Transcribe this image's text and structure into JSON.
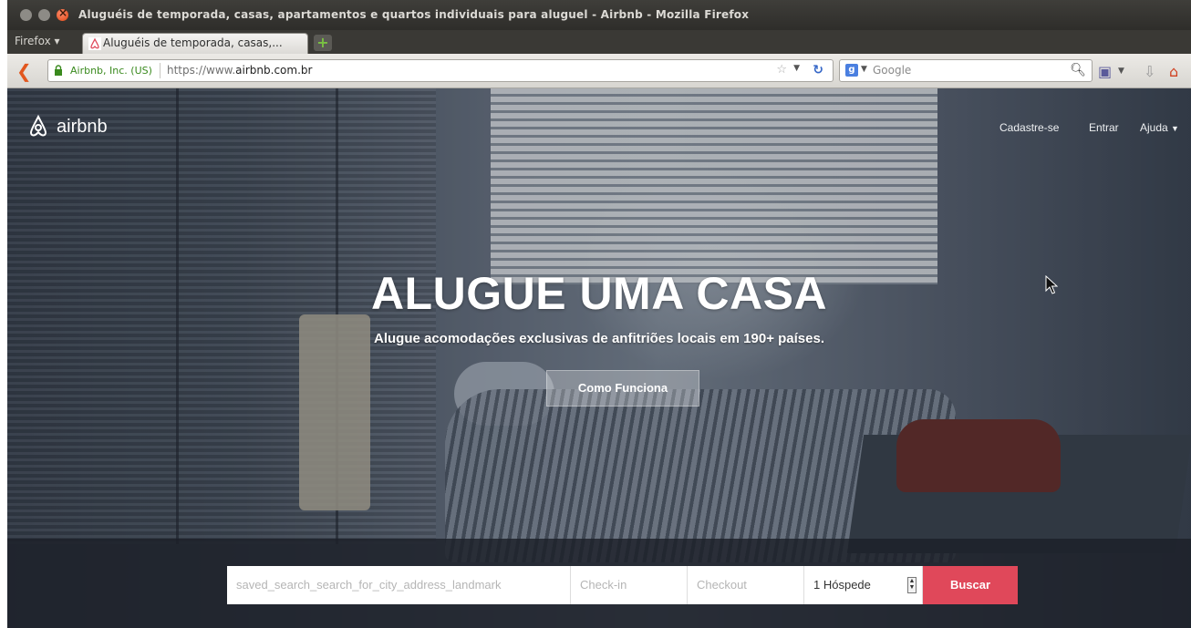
{
  "window": {
    "title": "Aluguéis de temporada, casas, apartamentos e quartos individuais para aluguel - Airbnb - Mozilla Firefox"
  },
  "browser": {
    "menu_label": "Firefox",
    "tab_label": "Aluguéis de temporada, casas,...",
    "new_tab": "+",
    "identity": "Airbnb, Inc. (US)",
    "url_prefix": "https://www.",
    "url_domain": "airbnb.com.br",
    "search_engine": "Google",
    "icons": [
      "back-arrow-icon",
      "lock-icon",
      "star-icon",
      "reload-icon",
      "google-icon",
      "magnifier-icon",
      "bookmark-icon",
      "download-icon",
      "home-icon"
    ]
  },
  "site": {
    "logo_text": "airbnb",
    "nav": {
      "signup": "Cadastre-se",
      "login": "Entrar",
      "help": "Ajuda"
    },
    "hero": {
      "headline": "ALUGUE UMA CASA",
      "subline": "Alugue acomodações exclusivas de anfitriões locais em 190+ países.",
      "how_button": "Como Funciona"
    },
    "search": {
      "location_placeholder": "saved_search_search_for_city_address_landmark",
      "checkin_placeholder": "Check-in",
      "checkout_placeholder": "Checkout",
      "guests_value": "1 Hóspede",
      "submit": "Buscar"
    },
    "colors": {
      "brand": "#e0485a",
      "ff_orange": "#e2571e"
    }
  }
}
